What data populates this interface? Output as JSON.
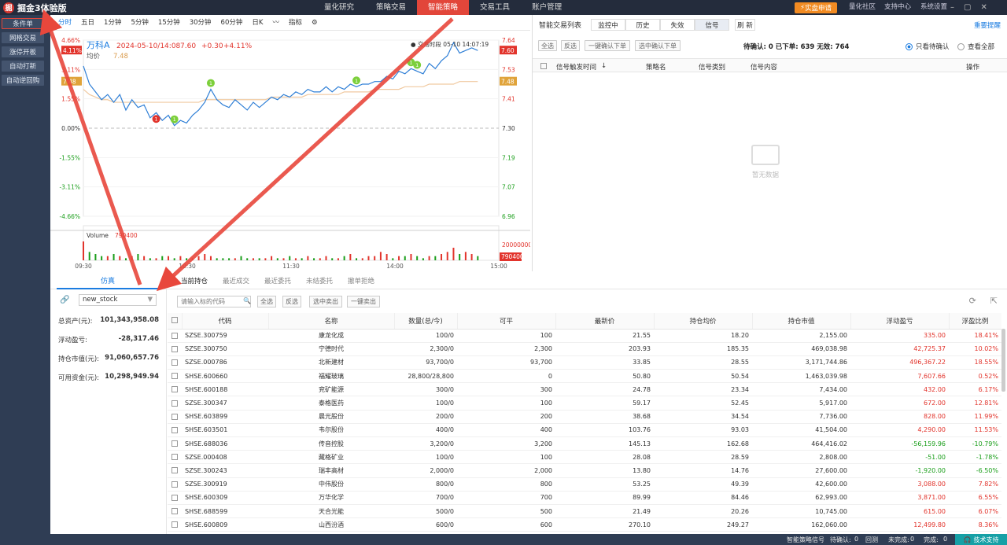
{
  "app": {
    "title": "掘金3体验版",
    "logo_char": "掘"
  },
  "nav": [
    {
      "label": "量化研究",
      "active": false
    },
    {
      "label": "策略交易",
      "active": false
    },
    {
      "label": "智能策略",
      "active": true
    },
    {
      "label": "交易工具",
      "active": false
    },
    {
      "label": "账户管理",
      "active": false
    }
  ],
  "topright": {
    "live_btn": "实盘申请",
    "community": "量化社区",
    "support": "支持中心",
    "settings": "系统设置"
  },
  "sidebar": [
    {
      "label": "条件单",
      "selected": true
    },
    {
      "label": "网格交易",
      "selected": false
    },
    {
      "label": "涨停开板",
      "selected": false
    },
    {
      "label": "自动打新",
      "selected": false
    },
    {
      "label": "自动逆回购",
      "selected": false
    }
  ],
  "chart_toolbar": [
    "分时",
    "五日",
    "1分钟",
    "5分钟",
    "15分钟",
    "30分钟",
    "60分钟",
    "日K",
    "指标"
  ],
  "chart_data": {
    "type": "line",
    "stock_name": "万科A",
    "datetime": "2024-05-10/14:08",
    "price": "7.60",
    "change": "+0.30",
    "change_pct": "+4.11%",
    "avg_label": "均价",
    "avg_value": "7.48",
    "trade_time_label": "交易时段 05-10 14:07:19",
    "prev_close": 7.3,
    "ylim": [
      6.96,
      7.64
    ],
    "left_ticks": [
      "4.66%",
      "3.11%",
      "1.55%",
      "0.00%",
      "-1.55%",
      "-3.11%",
      "-4.66%"
    ],
    "right_ticks": [
      "7.64",
      "7.53",
      "7.41",
      "7.30",
      "7.19",
      "7.07",
      "6.96"
    ],
    "price_tag": "7.60",
    "avg_tag": "7.48",
    "pct_tag": "4.11%",
    "x_ticks": [
      "09:30",
      "10:30",
      "11:30",
      "14:00",
      "15:00"
    ],
    "price_series": [
      7.54,
      7.47,
      7.44,
      7.41,
      7.43,
      7.4,
      7.43,
      7.37,
      7.41,
      7.38,
      7.39,
      7.34,
      7.36,
      7.33,
      7.35,
      7.31,
      7.33,
      7.32,
      7.35,
      7.37,
      7.4,
      7.45,
      7.41,
      7.39,
      7.38,
      7.41,
      7.39,
      7.37,
      7.4,
      7.38,
      7.4,
      7.42,
      7.41,
      7.43,
      7.42,
      7.44,
      7.43,
      7.45,
      7.44,
      7.44,
      7.46,
      7.44,
      7.46,
      7.45,
      7.47,
      7.46,
      7.47,
      7.47,
      7.48,
      7.48,
      7.5,
      7.49,
      7.52,
      7.51,
      7.53,
      7.52,
      7.51,
      7.55,
      7.53,
      7.56,
      7.58,
      7.63,
      7.59,
      7.6,
      7.61,
      7.6
    ],
    "avg_series": [
      7.45,
      7.43,
      7.42,
      7.41,
      7.41,
      7.4,
      7.4,
      7.4,
      7.4,
      7.4,
      7.4,
      7.4,
      7.4,
      7.4,
      7.4,
      7.4,
      7.4,
      7.4,
      7.4,
      7.4,
      7.41,
      7.41,
      7.41,
      7.41,
      7.41,
      7.41,
      7.41,
      7.41,
      7.41,
      7.41,
      7.41,
      7.42,
      7.42,
      7.42,
      7.42,
      7.42,
      7.42,
      7.43,
      7.43,
      7.43,
      7.43,
      7.43,
      7.43,
      7.44,
      7.44,
      7.44,
      7.44,
      7.44,
      7.45,
      7.45,
      7.45,
      7.45,
      7.45,
      7.46,
      7.46,
      7.46,
      7.46,
      7.47,
      7.47,
      7.47,
      7.47,
      7.47,
      7.48,
      7.48,
      7.48,
      7.48
    ],
    "signals": [
      {
        "idx": 20,
        "type": "buy"
      },
      {
        "idx": 27,
        "type": "buy"
      },
      {
        "idx": 15,
        "type": "sell"
      },
      {
        "idx": 58,
        "type": "buy"
      },
      {
        "idx": 70,
        "type": "buy"
      },
      {
        "idx": 71,
        "type": "buy"
      }
    ],
    "volume_label": "Volume",
    "volume_value": "790400",
    "volume_max_label": "20000000",
    "volume_tag": "790400",
    "volumes": [
      9,
      4,
      3,
      2,
      2,
      3,
      2,
      1,
      2,
      3,
      2,
      1,
      1,
      2,
      2,
      1,
      2,
      1,
      1,
      2,
      3,
      2,
      1,
      1,
      1,
      1,
      2,
      1,
      1,
      1,
      1,
      2,
      1,
      1,
      2,
      1,
      1,
      2,
      1,
      1,
      2,
      1,
      1,
      2,
      3,
      1,
      1,
      2,
      2,
      4,
      3,
      1,
      2,
      2,
      3,
      2,
      1,
      2,
      2,
      3,
      4,
      6,
      3,
      4,
      3,
      2
    ]
  },
  "signal_panel": {
    "title": "智能交易列表",
    "tabs": [
      {
        "label": "监控中",
        "active": false
      },
      {
        "label": "历史",
        "active": false
      },
      {
        "label": "失效",
        "active": false
      },
      {
        "label": "信号",
        "active": true
      }
    ],
    "refresh": "刷 新",
    "help": "重要提醒",
    "buttons": [
      "全选",
      "反选",
      "一键确认下单",
      "选中确认下单"
    ],
    "stats": "待确认: 0  已下单: 639  无效: 764",
    "radio_pending": "只看待确认",
    "radio_all": "查看全部",
    "columns": [
      "信号触发时间",
      "策略名",
      "信号类别",
      "信号内容",
      "操作"
    ],
    "empty": "暂无数据"
  },
  "lower_tabs": [
    "当前持仓",
    "最近成交",
    "最近委托",
    "未结委托",
    "撤单拒绝"
  ],
  "sim_tab": "仿真",
  "account": {
    "selected": "new_stock",
    "rows": [
      {
        "label": "总资产(元):",
        "value": "101,343,958.08"
      },
      {
        "label": "浮动盈亏:",
        "value": "-28,317.46"
      },
      {
        "label": "持仓市值(元):",
        "value": "91,060,657.76"
      },
      {
        "label": "可用资金(元):",
        "value": "10,298,949.94"
      }
    ]
  },
  "table_toolbar": {
    "search_placeholder": "请输入标的代码",
    "buttons": [
      "全选",
      "反选",
      "选中卖出",
      "一键卖出"
    ]
  },
  "positions": {
    "columns": [
      "代码",
      "名称",
      "数量(总/今)",
      "可平",
      "最新价",
      "持仓均价",
      "持仓市值",
      "浮动盈亏",
      "浮盈比例"
    ],
    "rows": [
      [
        "SZSE.300759",
        "康龙化成",
        "100/0",
        "100",
        "21.55",
        "18.20",
        "2,155.00",
        "335.00",
        "18.41%"
      ],
      [
        "SZSE.300750",
        "宁德时代",
        "2,300/0",
        "2,300",
        "203.93",
        "185.35",
        "469,038.98",
        "42,725.37",
        "10.02%"
      ],
      [
        "SZSE.000786",
        "北新建材",
        "93,700/0",
        "93,700",
        "33.85",
        "28.55",
        "3,171,744.86",
        "496,367.22",
        "18.55%"
      ],
      [
        "SHSE.600660",
        "福耀玻璃",
        "28,800/28,800",
        "0",
        "50.80",
        "50.54",
        "1,463,039.98",
        "7,607.66",
        "0.52%"
      ],
      [
        "SHSE.600188",
        "兖矿能源",
        "300/0",
        "300",
        "24.78",
        "23.34",
        "7,434.00",
        "432.00",
        "6.17%"
      ],
      [
        "SZSE.300347",
        "泰格医药",
        "100/0",
        "100",
        "59.17",
        "52.45",
        "5,917.00",
        "672.00",
        "12.81%"
      ],
      [
        "SHSE.603899",
        "晨光股份",
        "200/0",
        "200",
        "38.68",
        "34.54",
        "7,736.00",
        "828.00",
        "11.99%"
      ],
      [
        "SHSE.603501",
        "韦尔股份",
        "400/0",
        "400",
        "103.76",
        "93.03",
        "41,504.00",
        "4,290.00",
        "11.53%"
      ],
      [
        "SHSE.688036",
        "传音控股",
        "3,200/0",
        "3,200",
        "145.13",
        "162.68",
        "464,416.02",
        "-56,159.96",
        "-10.79%"
      ],
      [
        "SZSE.000408",
        "藏格矿业",
        "100/0",
        "100",
        "28.08",
        "28.59",
        "2,808.00",
        "-51.00",
        "-1.78%"
      ],
      [
        "SZSE.300243",
        "瑞丰高材",
        "2,000/0",
        "2,000",
        "13.80",
        "14.76",
        "27,600.00",
        "-1,920.00",
        "-6.50%"
      ],
      [
        "SZSE.300919",
        "中伟股份",
        "800/0",
        "800",
        "53.25",
        "49.39",
        "42,600.00",
        "3,088.00",
        "7.82%"
      ],
      [
        "SHSE.600309",
        "万华化学",
        "700/0",
        "700",
        "89.99",
        "84.46",
        "62,993.00",
        "3,871.00",
        "6.55%"
      ],
      [
        "SHSE.688599",
        "天合光能",
        "500/0",
        "500",
        "21.49",
        "20.26",
        "10,745.00",
        "615.00",
        "6.07%"
      ],
      [
        "SHSE.600809",
        "山西汾酒",
        "600/0",
        "600",
        "270.10",
        "249.27",
        "162,060.00",
        "12,499.80",
        "8.36%"
      ]
    ]
  },
  "statusbar": {
    "signal": "智能策略信号",
    "pending_label": "待确认:",
    "pending": "0",
    "test": "回测",
    "unfinished_label": "未完成:",
    "unfinished": "0",
    "finished_label": "完成:",
    "finished": "0",
    "support": "技术支持"
  },
  "colors": {
    "accent": "#1b7ce0",
    "up": "#e2342c",
    "down": "#1a9e1a",
    "nav_active": "#e2463a",
    "arrow": "#e8473c"
  }
}
